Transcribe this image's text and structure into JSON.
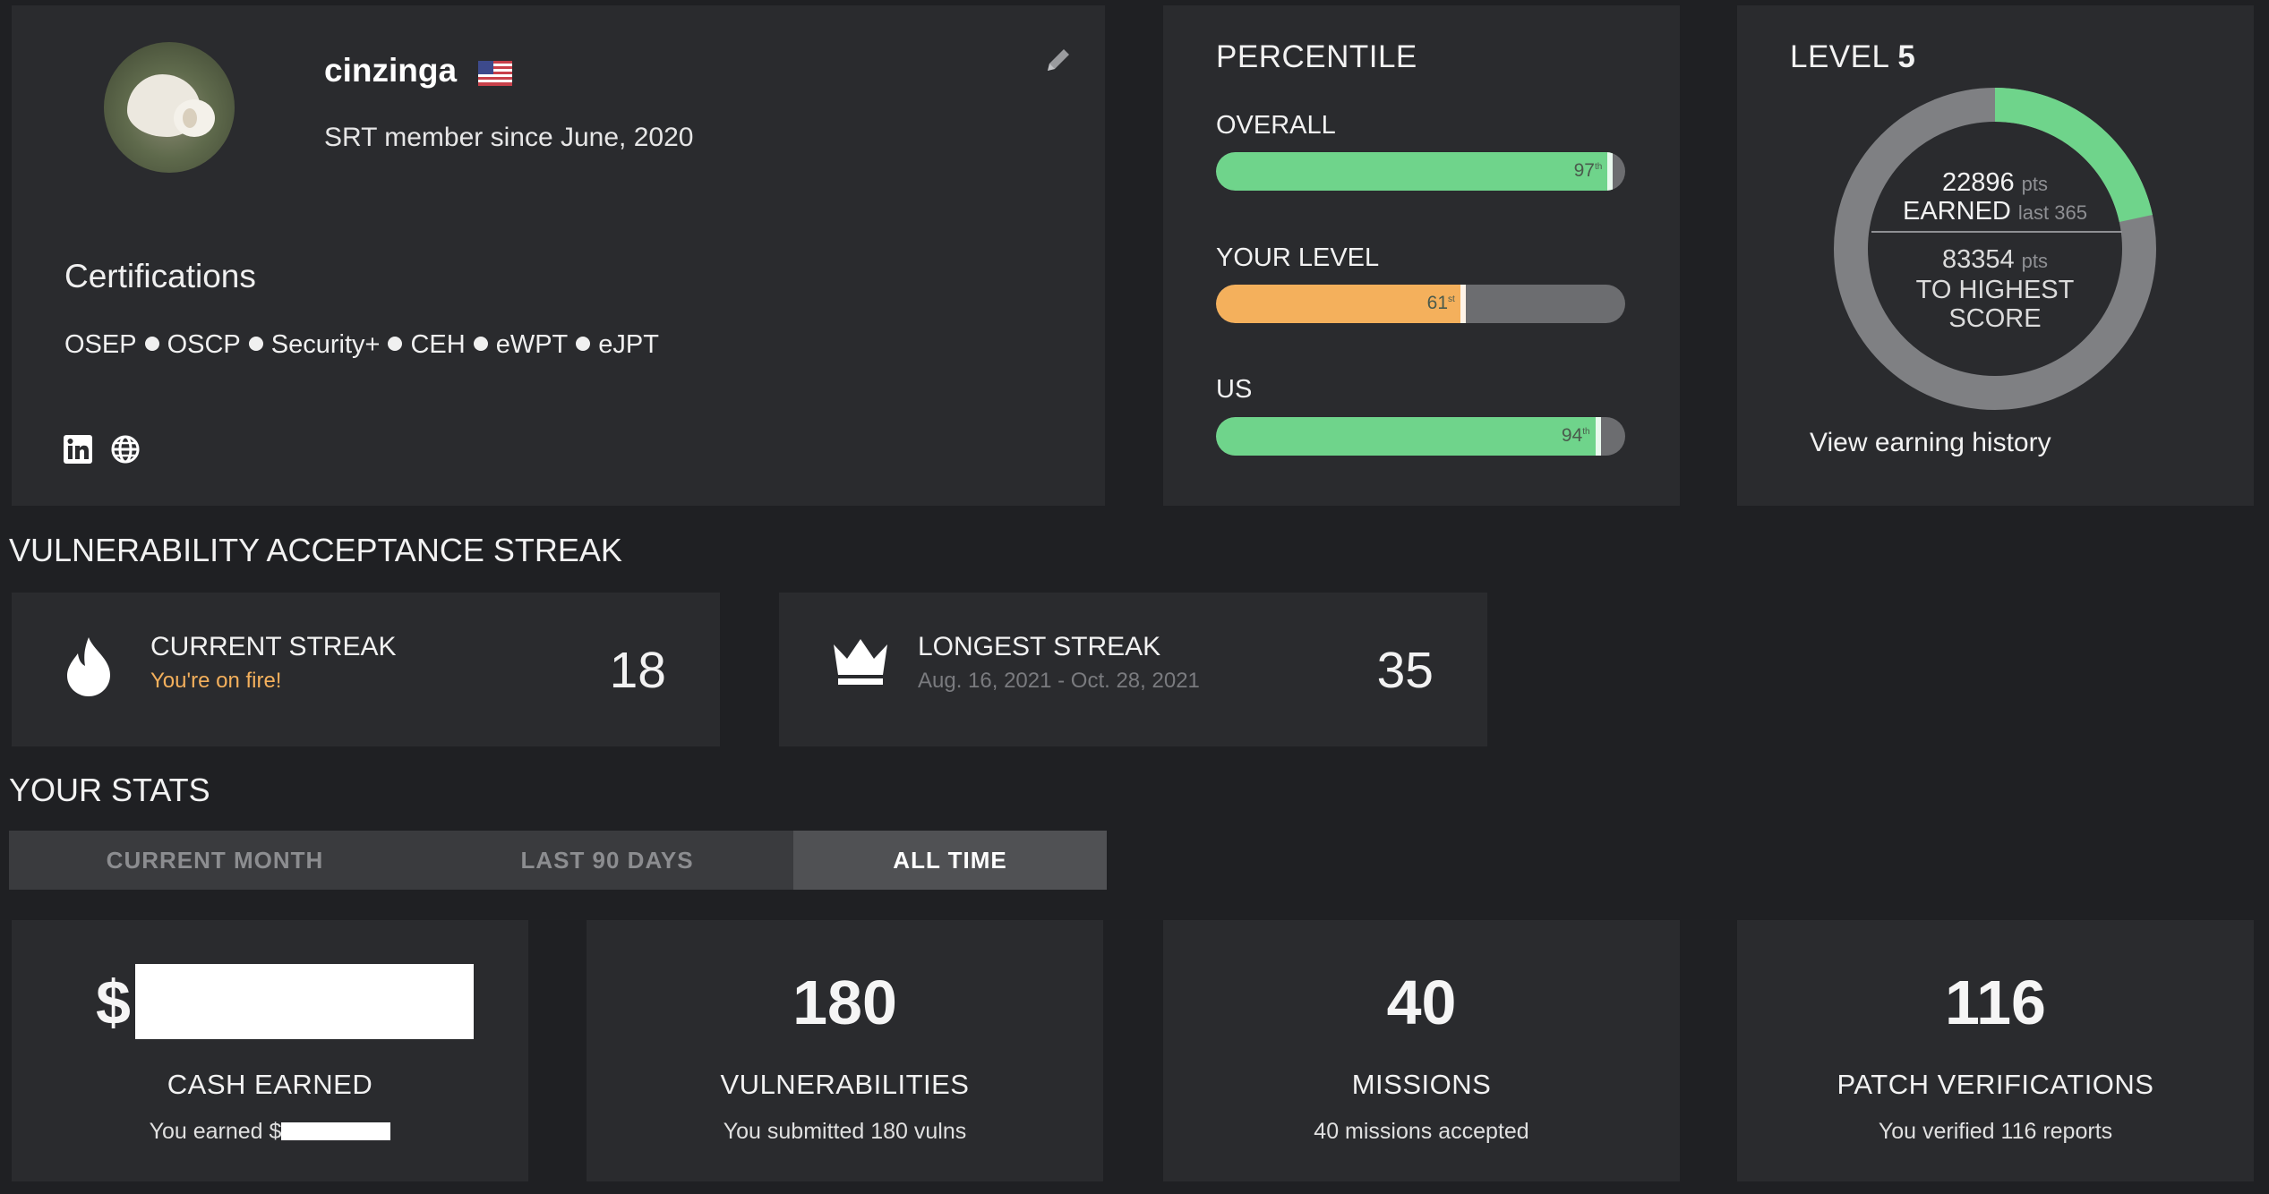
{
  "profile": {
    "username": "cinzinga",
    "flag_icon": "us-flag-icon",
    "member_since": "SRT member since June, 2020",
    "certifications_title": "Certifications",
    "certifications": [
      "OSEP",
      "OSCP",
      "Security+",
      "CEH",
      "eWPT",
      "eJPT"
    ],
    "social_icons": [
      "linkedin-icon",
      "globe-icon"
    ]
  },
  "percentile": {
    "title": "PERCENTILE",
    "bars": [
      {
        "label": "OVERALL",
        "value": 97,
        "display": "97",
        "color": "#6fd48b"
      },
      {
        "label": "YOUR LEVEL",
        "value": 61,
        "display": "61",
        "color": "#f4b05c"
      },
      {
        "label": "US",
        "value": 94,
        "display": "94",
        "color": "#6fd48b"
      }
    ]
  },
  "level": {
    "title_prefix": "LEVEL",
    "level_number": "5",
    "earned_points": "22896",
    "pts_unit": "pts",
    "earned_label": "EARNED",
    "earned_window": "last 365",
    "to_highest_points": "83354",
    "to_highest_label_1": "TO HIGHEST",
    "to_highest_label_2": "SCORE",
    "progress_fraction": 0.216,
    "view_history": "View earning history",
    "ring_color": "#6fd48b",
    "ring_track_color": "#7f8083"
  },
  "streak": {
    "section_title": "VULNERABILITY ACCEPTANCE STREAK",
    "current": {
      "label": "CURRENT STREAK",
      "sub": "You're on fire!",
      "value": "18",
      "sub_color": "#f4b05c",
      "icon": "fire-icon"
    },
    "longest": {
      "label": "LONGEST STREAK",
      "sub": "Aug. 16, 2021 - Oct. 28, 2021",
      "value": "35",
      "sub_color": "#7a7b7f",
      "icon": "crown-icon"
    }
  },
  "stats": {
    "section_title": "YOUR STATS",
    "tabs": [
      "CURRENT MONTH",
      "LAST 90 DAYS",
      "ALL TIME"
    ],
    "active_tab": "ALL TIME",
    "cards": {
      "cash": {
        "currency": "$",
        "label": "CASH EARNED",
        "sub_prefix": "You earned $"
      },
      "vulns": {
        "value": "180",
        "label": "VULNERABILITIES",
        "sub": "You submitted 180 vulns"
      },
      "missions": {
        "value": "40",
        "label": "MISSIONS",
        "sub": "40 missions accepted"
      },
      "patch": {
        "value": "116",
        "label": "PATCH VERIFICATIONS",
        "sub": "You verified 116 reports"
      }
    }
  }
}
